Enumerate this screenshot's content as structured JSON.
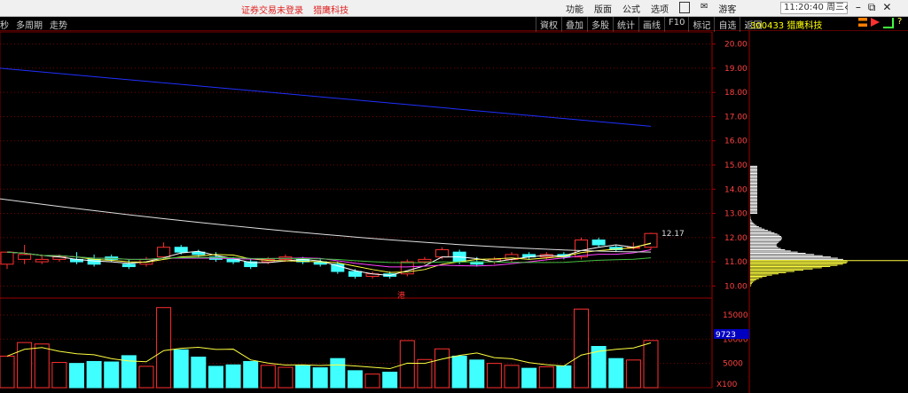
{
  "window": {
    "title_status": "证券交易未登录",
    "title_name": "猎鹰科技",
    "menu": [
      "功能",
      "版面",
      "公式",
      "选项"
    ],
    "account": "游客",
    "clock": "11:20:40 周三",
    "controls": [
      "‹",
      "–",
      "⧉",
      "✕"
    ]
  },
  "toolbar": {
    "left": [
      "秒",
      "多周期",
      "走势"
    ],
    "right": [
      "叠加",
      "多股",
      "统计",
      "画线",
      "F10",
      "标记",
      "自选",
      "返回"
    ],
    "first_right": "資权"
  },
  "stock": {
    "code": "300433",
    "name": "猎鹰科技"
  },
  "price_axis": [
    "20.00",
    "19.00",
    "18.00",
    "17.00",
    "16.00",
    "15.00",
    "14.00",
    "13.00",
    "12.00",
    "11.00",
    "10.00"
  ],
  "last_price_label": "12.17",
  "volume_axis": [
    "15000",
    "10000",
    "5000"
  ],
  "volume_marker": "9723",
  "volume_unit": "X100",
  "marker_text": "港",
  "colors": {
    "up": "#ff3030",
    "down": "#40ffff",
    "ma_white": "#ffffff",
    "ma_yellow": "#ffff40",
    "ma_magenta": "#ff40ff",
    "ma_green": "#40c040",
    "ma_blue": "#2030ff",
    "grid": "#7a0000"
  },
  "chart_data": {
    "type": "candlestick",
    "price_range": [
      9.5,
      20.5
    ],
    "volume_range": [
      0,
      17000
    ],
    "candles": [
      {
        "o": 10.9,
        "c": 11.4,
        "h": 11.4,
        "l": 10.7,
        "v": 6500
      },
      {
        "o": 11.1,
        "c": 11.3,
        "h": 11.7,
        "l": 10.9,
        "v": 9300
      },
      {
        "o": 11.0,
        "c": 11.1,
        "h": 11.3,
        "l": 10.9,
        "v": 9000
      },
      {
        "o": 11.1,
        "c": 11.2,
        "h": 11.3,
        "l": 11.0,
        "v": 5200
      },
      {
        "o": 11.1,
        "c": 11.0,
        "h": 11.4,
        "l": 10.9,
        "v": 5000
      },
      {
        "o": 11.1,
        "c": 10.9,
        "h": 11.3,
        "l": 10.8,
        "v": 5400
      },
      {
        "o": 11.2,
        "c": 11.1,
        "h": 11.3,
        "l": 11.0,
        "v": 5300
      },
      {
        "o": 10.9,
        "c": 10.8,
        "h": 11.1,
        "l": 10.7,
        "v": 6600
      },
      {
        "o": 10.9,
        "c": 11.1,
        "h": 11.2,
        "l": 10.8,
        "v": 4400
      },
      {
        "o": 11.2,
        "c": 11.6,
        "h": 11.8,
        "l": 11.1,
        "v": 16500
      },
      {
        "o": 11.6,
        "c": 11.4,
        "h": 11.7,
        "l": 11.3,
        "v": 7800
      },
      {
        "o": 11.4,
        "c": 11.3,
        "h": 11.5,
        "l": 11.2,
        "v": 6300
      },
      {
        "o": 11.2,
        "c": 11.1,
        "h": 11.4,
        "l": 11.0,
        "v": 4400
      },
      {
        "o": 11.1,
        "c": 11.0,
        "h": 11.2,
        "l": 10.9,
        "v": 4700
      },
      {
        "o": 11.0,
        "c": 10.8,
        "h": 11.1,
        "l": 10.7,
        "v": 5400
      },
      {
        "o": 11.0,
        "c": 11.1,
        "h": 11.2,
        "l": 10.9,
        "v": 4600
      },
      {
        "o": 11.1,
        "c": 11.2,
        "h": 11.3,
        "l": 11.0,
        "v": 4200
      },
      {
        "o": 11.1,
        "c": 11.0,
        "h": 11.2,
        "l": 10.9,
        "v": 4600
      },
      {
        "o": 11.0,
        "c": 10.9,
        "h": 11.1,
        "l": 10.8,
        "v": 4100
      },
      {
        "o": 10.9,
        "c": 10.6,
        "h": 11.0,
        "l": 10.5,
        "v": 6000
      },
      {
        "o": 10.6,
        "c": 10.4,
        "h": 10.7,
        "l": 10.3,
        "v": 3500
      },
      {
        "o": 10.4,
        "c": 10.5,
        "h": 10.6,
        "l": 10.3,
        "v": 2800
      },
      {
        "o": 10.5,
        "c": 10.4,
        "h": 10.6,
        "l": 10.3,
        "v": 3200
      },
      {
        "o": 10.5,
        "c": 11.0,
        "h": 11.1,
        "l": 10.4,
        "v": 9700
      },
      {
        "o": 11.0,
        "c": 11.1,
        "h": 11.2,
        "l": 10.9,
        "v": 5800
      },
      {
        "o": 11.2,
        "c": 11.5,
        "h": 11.6,
        "l": 11.1,
        "v": 8000
      },
      {
        "o": 11.4,
        "c": 11.0,
        "h": 11.5,
        "l": 10.9,
        "v": 6500
      },
      {
        "o": 11.0,
        "c": 10.9,
        "h": 11.2,
        "l": 10.8,
        "v": 5700
      },
      {
        "o": 11.0,
        "c": 11.1,
        "h": 11.2,
        "l": 10.9,
        "v": 5000
      },
      {
        "o": 11.1,
        "c": 11.3,
        "h": 11.4,
        "l": 11.0,
        "v": 4600
      },
      {
        "o": 11.3,
        "c": 11.2,
        "h": 11.4,
        "l": 11.1,
        "v": 4000
      },
      {
        "o": 11.2,
        "c": 11.3,
        "h": 11.4,
        "l": 11.1,
        "v": 4300
      },
      {
        "o": 11.3,
        "c": 11.2,
        "h": 11.4,
        "l": 11.1,
        "v": 4500
      },
      {
        "o": 11.2,
        "c": 11.9,
        "h": 12.0,
        "l": 11.1,
        "v": 16200
      },
      {
        "o": 11.9,
        "c": 11.7,
        "h": 12.0,
        "l": 11.6,
        "v": 8500
      },
      {
        "o": 11.6,
        "c": 11.5,
        "h": 11.7,
        "l": 11.4,
        "v": 6000
      },
      {
        "o": 11.6,
        "c": 11.6,
        "h": 11.8,
        "l": 11.5,
        "v": 5700
      },
      {
        "o": 11.6,
        "c": 12.17,
        "h": 12.2,
        "l": 11.5,
        "v": 9723
      }
    ],
    "ma_blue": {
      "from": 19.0,
      "to": 16.6
    },
    "ma_white": {
      "from": 13.6,
      "to": 11.4
    }
  }
}
